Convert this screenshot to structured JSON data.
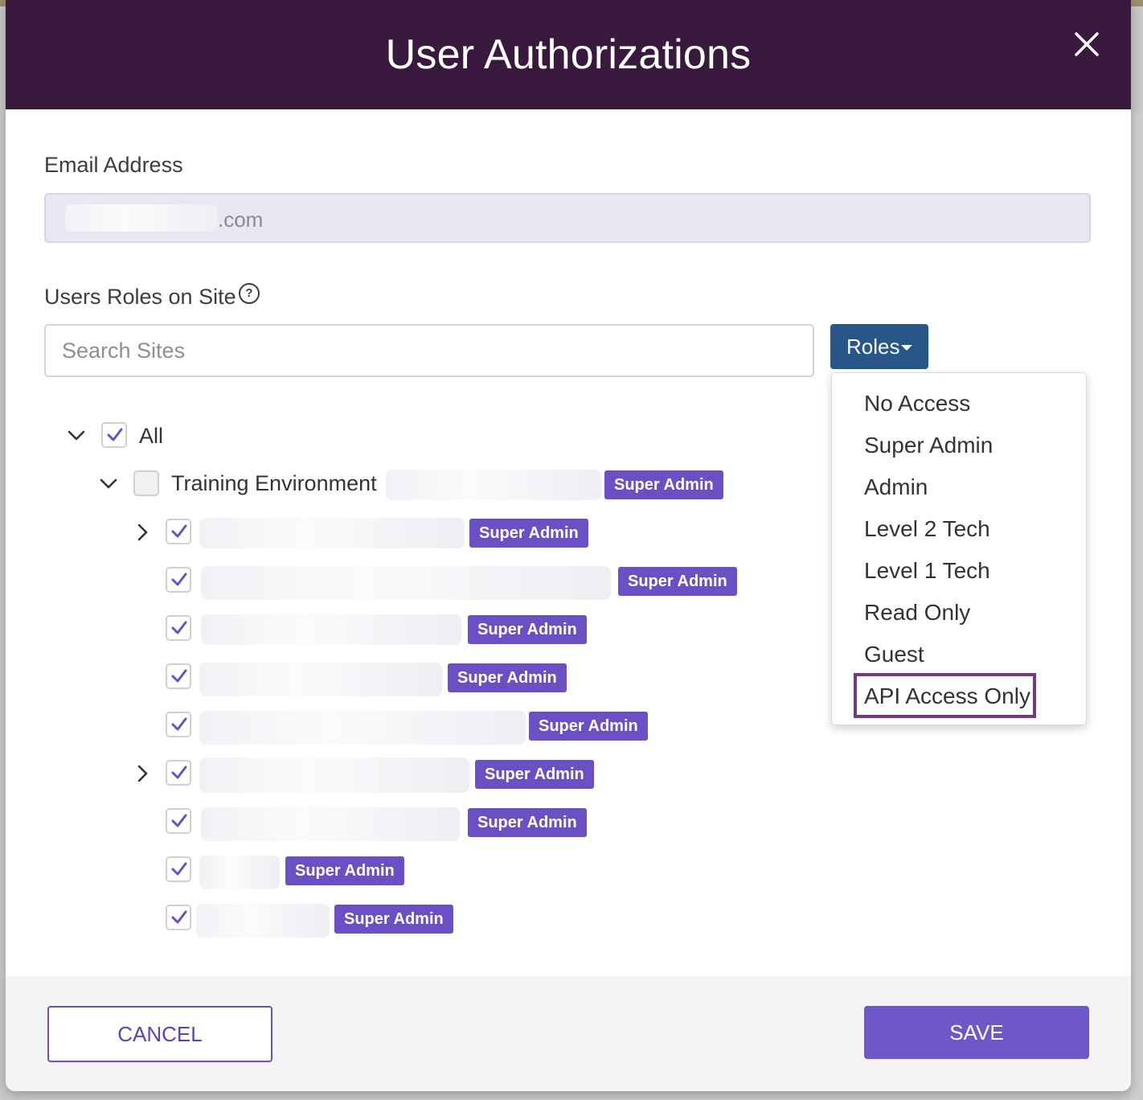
{
  "modal": {
    "title": "User Authorizations",
    "close_icon": "close-icon"
  },
  "email": {
    "label": "Email Address",
    "value_visible": ".com"
  },
  "roles_section": {
    "label": "Users Roles on Site",
    "help_icon": "question-circle-icon",
    "search_placeholder": "Search Sites",
    "roles_button": "Roles"
  },
  "dropdown": {
    "items": [
      "No Access",
      "Super Admin",
      "Admin",
      "Level 2 Tech",
      "Level 1 Tech",
      "Read Only",
      "Guest",
      "API Access Only"
    ],
    "highlighted": "API Access Only"
  },
  "tree": {
    "all_label": "All",
    "all_checked": true,
    "group_label": "Training Environment",
    "group_badge": "Super Admin",
    "group_checked": false,
    "sites": [
      {
        "expandable": true,
        "checked": true,
        "badge": "Super Admin"
      },
      {
        "expandable": false,
        "checked": true,
        "badge": "Super Admin"
      },
      {
        "expandable": false,
        "checked": true,
        "badge": "Super Admin"
      },
      {
        "expandable": false,
        "checked": true,
        "badge": "Super Admin"
      },
      {
        "expandable": false,
        "checked": true,
        "badge": "Super Admin"
      },
      {
        "expandable": true,
        "checked": true,
        "badge": "Super Admin"
      },
      {
        "expandable": false,
        "checked": true,
        "badge": "Super Admin"
      },
      {
        "expandable": false,
        "checked": true,
        "badge": "Super Admin"
      },
      {
        "expandable": false,
        "checked": true,
        "badge": "Super Admin"
      }
    ]
  },
  "footer": {
    "cancel": "CANCEL",
    "save": "SAVE"
  },
  "colors": {
    "header_bg": "#39193d",
    "accent_purple": "#6b4fc5",
    "roles_button_bg": "#265788",
    "highlight_border": "#6f3b8a"
  }
}
